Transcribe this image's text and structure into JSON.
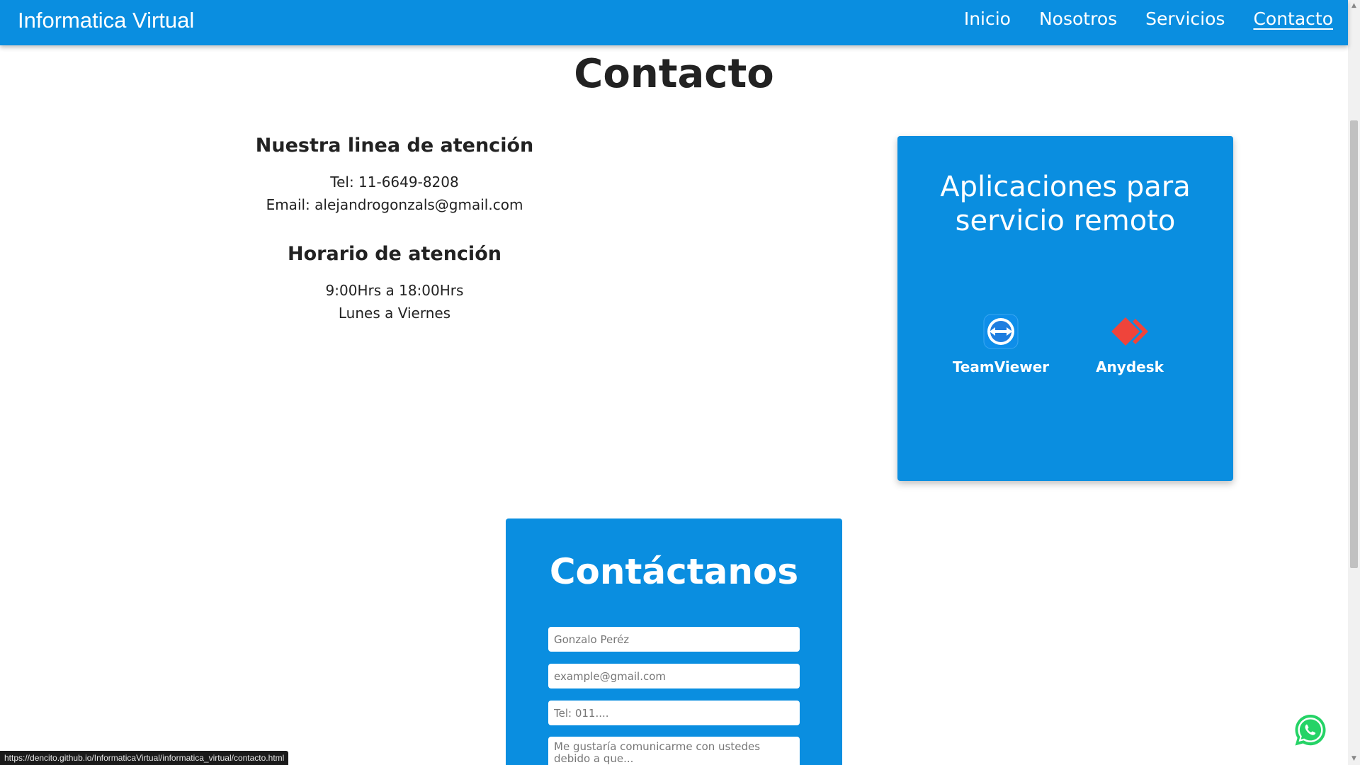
{
  "navbar": {
    "brand": "Informatica Virtual",
    "links": [
      "Inicio",
      "Nosotros",
      "Servicios",
      "Contacto"
    ],
    "active": "Contacto",
    "color": "#0a8ee0"
  },
  "main": {
    "title": "Contacto",
    "support": {
      "heading": "Nuestra linea de atención",
      "phone": "Tel: 11-6649-8208",
      "email": "Email: alejandrogonzals@gmail.com"
    },
    "hours": {
      "heading": "Horario de atención",
      "time": "9:00Hrs a 18:00Hrs",
      "days": "Lunes a Viernes"
    }
  },
  "remote": {
    "title_line1": "Aplicaciones para",
    "title_line2": "servicio remoto",
    "apps": [
      {
        "label": "TeamViewer",
        "icon": "teamviewer-icon"
      },
      {
        "label": "Anydesk",
        "icon": "anydesk-icon"
      }
    ]
  },
  "form": {
    "title": "Contáctanos",
    "name_placeholder": "Gonzalo Peréz",
    "email_placeholder": "example@gmail.com",
    "phone_placeholder": "Tel: 011....",
    "message_placeholder": "Me gustaría comunicarme con ustedes debido a que..."
  },
  "status_bar": {
    "url": "https://dencito.github.io/InformaticaVirtual/informatica_virtual/contacto.html"
  },
  "floating": {
    "icon": "whatsapp-icon",
    "color": "#25d366"
  }
}
